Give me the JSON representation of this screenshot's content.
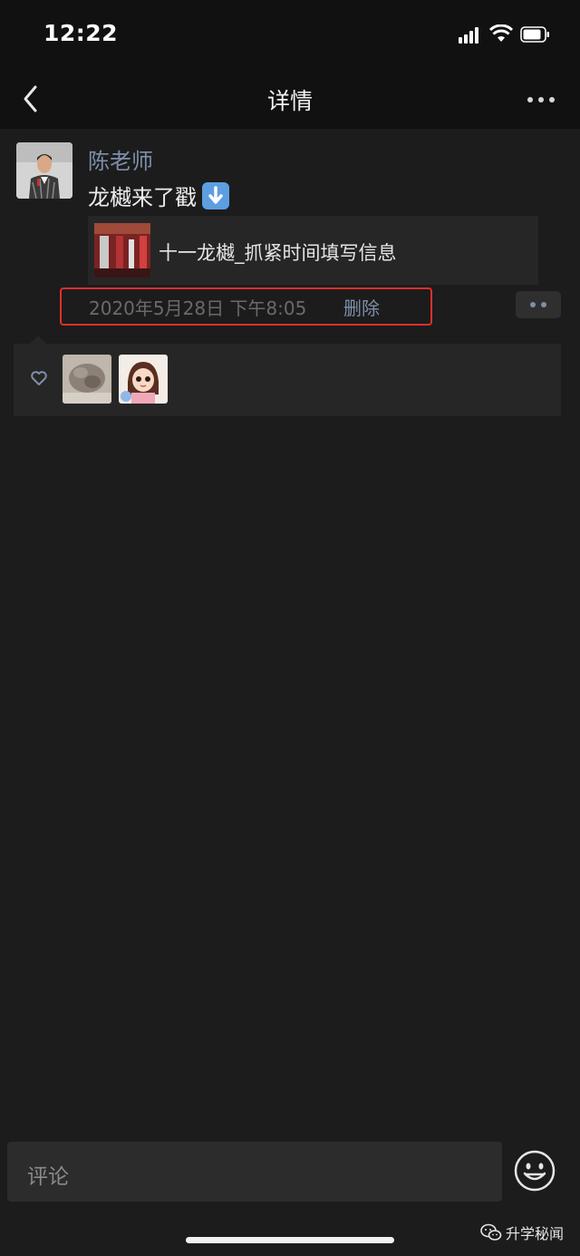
{
  "status_bar": {
    "time": "12:22"
  },
  "nav": {
    "title": "详情",
    "back_icon": "chevron-left-icon",
    "more_icon": "more-dots-icon"
  },
  "post": {
    "author": "陈老师",
    "text": "龙樾来了戳",
    "emoji": "down-arrow-emoji",
    "link_card": {
      "title": "十一龙樾_抓紧时间填写信息"
    },
    "timestamp": "2020年5月28日 下午8:05",
    "delete_label": "删除",
    "highlight_color": "#e0302a"
  },
  "likes": {
    "icon": "heart-icon",
    "count_avatars": 2
  },
  "comment": {
    "placeholder": "评论",
    "emoji_icon": "smiley-icon"
  },
  "watermark": {
    "text": "升学秘闻"
  },
  "colors": {
    "link_blue": "#7d90a9",
    "background": "#1c1c1c",
    "bar": "#111111",
    "card": "#262626"
  }
}
